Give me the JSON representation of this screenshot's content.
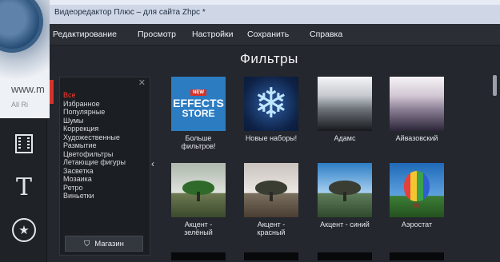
{
  "window": {
    "title": "Видеоредактор Плюс – для сайта Zhpc *"
  },
  "logo": {
    "www_text": "www.m",
    "rights_text": "All Ri"
  },
  "menu": {
    "items": [
      "Редактирование",
      "Просмотр",
      "Настройки",
      "Сохранить",
      "Справка"
    ]
  },
  "filters": {
    "title": "Фильтры",
    "categories": [
      {
        "label": "Все",
        "active": true
      },
      {
        "label": "Избранное",
        "active": false
      },
      {
        "label": "Популярные",
        "active": false
      },
      {
        "label": "Шумы",
        "active": false
      },
      {
        "label": "Коррекция",
        "active": false
      },
      {
        "label": "Художественные",
        "active": false
      },
      {
        "label": "Размытие",
        "active": false
      },
      {
        "label": "Цветофильтры",
        "active": false
      },
      {
        "label": "Летающие фигуры",
        "active": false
      },
      {
        "label": "Засветка",
        "active": false
      },
      {
        "label": "Мозаика",
        "active": false
      },
      {
        "label": "Ретро",
        "active": false
      },
      {
        "label": "Виньетки",
        "active": false
      }
    ],
    "shop_label": "Магазин",
    "tiles": [
      {
        "label": "Больше фильтров!",
        "thumb": "effects-store",
        "thumb_text": {
          "badge": "NEW",
          "line1": "EFFECTS",
          "line2": "STORE"
        }
      },
      {
        "label": "Новые наборы!",
        "thumb": "snowflake"
      },
      {
        "label": "Адамс",
        "thumb": "gradient-gray"
      },
      {
        "label": "Айвазовский",
        "thumb": "gradient-violet"
      },
      {
        "label": "Акцент - зелёный",
        "thumb": "tree-green"
      },
      {
        "label": "Акцент - красный",
        "thumb": "tree-red"
      },
      {
        "label": "Акцент - синий",
        "thumb": "tree-blue"
      },
      {
        "label": "Аэростат",
        "thumb": "balloon"
      }
    ]
  },
  "toolbar": {
    "icons": [
      "film-icon",
      "text-icon",
      "sticker-icon"
    ]
  },
  "colors": {
    "accent": "#d6332b",
    "active_category": "#ff3b30",
    "background": "#24272d"
  }
}
